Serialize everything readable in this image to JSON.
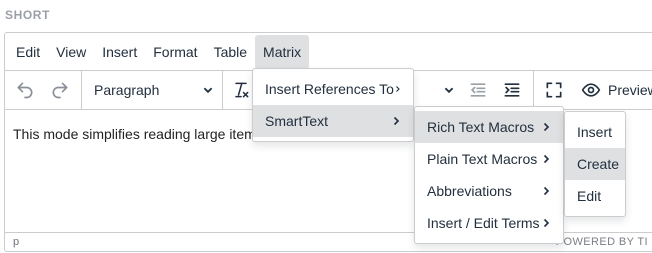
{
  "field_label": "SHORT",
  "menubar": {
    "items": [
      "Edit",
      "View",
      "Insert",
      "Format",
      "Table",
      "Matrix"
    ],
    "active": "Matrix"
  },
  "toolbar": {
    "block_format": "Paragraph",
    "preview_label": "Preview"
  },
  "content": {
    "text": "This mode simplifies reading large item"
  },
  "statusbar": {
    "path": "p",
    "powered": "POWERED BY TI"
  },
  "menus": {
    "matrix": {
      "items": [
        {
          "label": "Insert References To",
          "has_submenu": true
        },
        {
          "label": "SmartText",
          "has_submenu": true,
          "active": true
        }
      ]
    },
    "smarttext": {
      "items": [
        {
          "label": "Rich Text Macros",
          "has_submenu": true,
          "active": true
        },
        {
          "label": "Plain Text Macros",
          "has_submenu": true
        },
        {
          "label": "Abbreviations",
          "has_submenu": true
        },
        {
          "label": "Insert / Edit Terms",
          "has_submenu": true
        }
      ]
    },
    "rich_text_macros": {
      "items": [
        {
          "label": "Insert"
        },
        {
          "label": "Create",
          "active": true
        },
        {
          "label": "Edit"
        }
      ]
    }
  },
  "colors": {
    "border": "#cccccc",
    "active_bg": "#dee0e2",
    "text": "#222f3e"
  }
}
